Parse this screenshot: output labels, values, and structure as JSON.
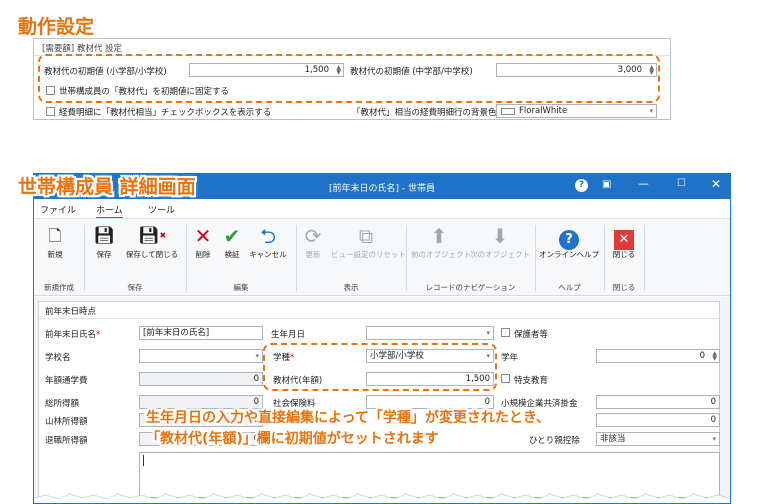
{
  "callouts": {
    "top": "動作設定",
    "bottom": "世帯構成員 詳細画面",
    "note_line1": "生年月日の入力や直接編集によって「学種」が変更されたとき、",
    "note_line2": "「教材代(年額)」欄に初期値がセットされます"
  },
  "settings": {
    "group_title": "[需要額] 教材代 設定",
    "elem_label": "教材代の初期値 (小学部/小学校)",
    "elem_value": "1,500",
    "mid_label": "教材代の初期値 (中学部/中学校)",
    "mid_value": "3,000",
    "fix_label": "世帯構成員の「教材代」を初期値に固定する",
    "show_chk_label": "経費明細に「教材代相当」チェックボックスを表示する",
    "bg_label": "「教材代」相当の経費明細行の背景色",
    "bg_value": "FloralWhite"
  },
  "window": {
    "title": "[前年末日の氏名] - 世帯員",
    "title_help": "?",
    "menus": [
      "ファイル",
      "ホーム",
      "ツール"
    ],
    "ribbon": {
      "new": "新規",
      "save": "保存",
      "save_close": "保存して閉じる",
      "delete": "削除",
      "verify": "検証",
      "cancel": "キャンセル",
      "refresh": "更新",
      "view_reset": "ビュー設定のリセット",
      "prev": "前のオブジェクト",
      "next": "次のオブジェクト",
      "online_help": "オンラインヘルプ",
      "close": "閉じる",
      "groups": {
        "new_create": "新規作成",
        "save": "保存",
        "edit": "編集",
        "display": "表示",
        "nav": "レコードのナビゲーション",
        "help": "ヘルプ",
        "close": "閉じる"
      }
    },
    "form": {
      "section_title": "前年末日時点",
      "name_label": "前年末日氏名",
      "req_mark": "*",
      "name_value": "[前年末日の氏名]",
      "birth_label": "生年月日",
      "guardian_label": "保護者等",
      "school_name_label": "学校名",
      "school_type_label": "学種",
      "school_type_value": "小学部/小学校",
      "grade_label": "学年",
      "grade_value": "0",
      "commute_label": "年額通学費",
      "commute_value": "0",
      "material_label": "教材代(年額)",
      "material_value": "1,500",
      "special_label": "特支教育",
      "income_total_label": "総所得額",
      "income_total_value": "0",
      "social_label": "社会保険料",
      "social_value": "0",
      "small_biz_label": "小規模企業共済掛金",
      "small_biz_value": "0",
      "forest_label": "山林所得額",
      "forest_value": "0",
      "retire_label": "退職所得額",
      "retire_value": "0",
      "dep_label": "ひとり親控除",
      "dep_value": "非該当",
      "row_values": [
        "0",
        "0"
      ]
    }
  },
  "colors": {
    "accent": "#e8730f",
    "titlebar": "#1e73c8",
    "delete_red": "#d0021b",
    "verify_green": "#2e9a3a",
    "help_blue": "#1e73c8"
  }
}
